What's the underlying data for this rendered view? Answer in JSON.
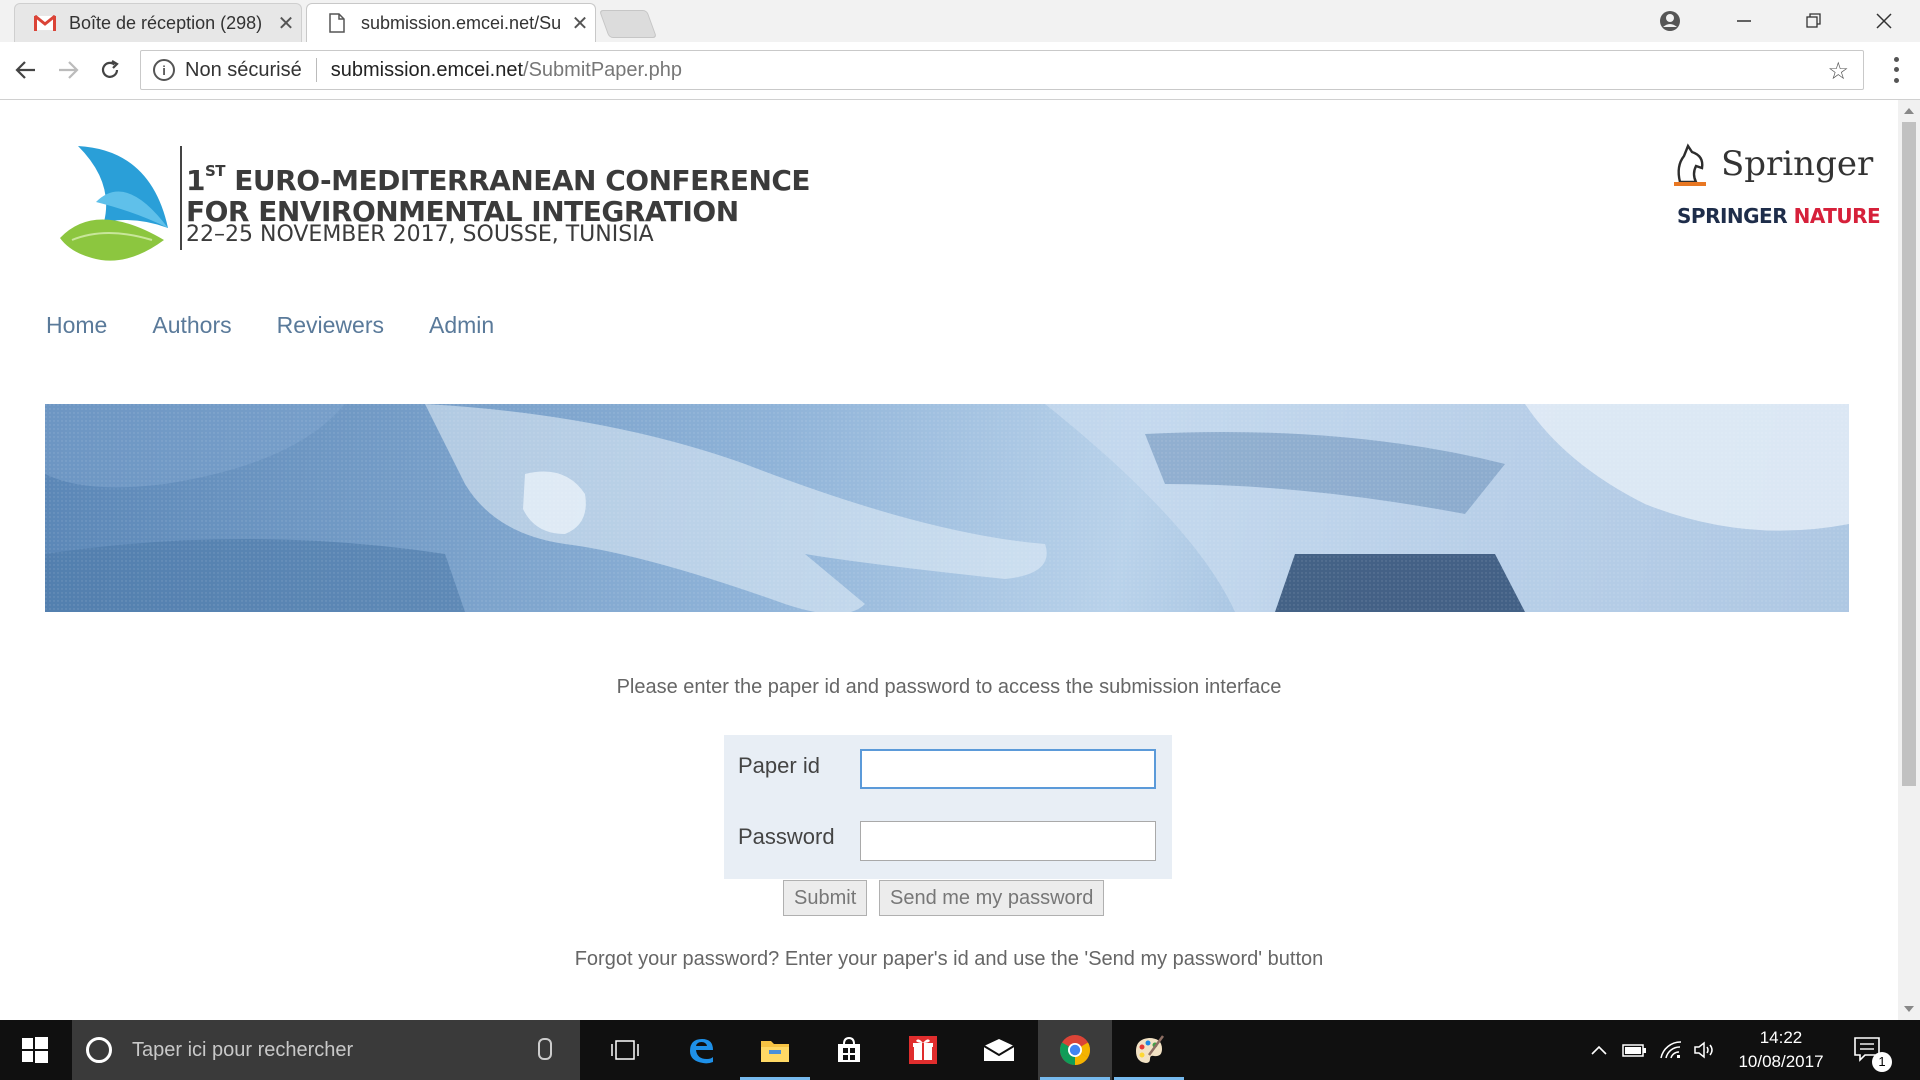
{
  "browser": {
    "tabs": [
      {
        "title": "Boîte de réception (298)",
        "icon": "gmail-icon",
        "active": false
      },
      {
        "title": "submission.emcei.net/Su",
        "icon": "page-icon",
        "active": true
      }
    ],
    "address": {
      "security_label": "Non sécurisé",
      "host": "submission.emcei.net",
      "path": "/SubmitPaper.php"
    }
  },
  "header": {
    "title_num": "1",
    "title_sup": "ST",
    "title_line1_rest": " EURO-MEDITERRANEAN CONFERENCE",
    "title_line2": "FOR ENVIRONMENTAL INTEGRATION",
    "date_place": "22–25 NOVEMBER 2017, SOUSSE, TUNISIA",
    "publisher": "Springer",
    "publisher_sub_1": "SPRINGER",
    "publisher_sub_2": "NATURE"
  },
  "nav": {
    "items": [
      "Home",
      "Authors",
      "Reviewers",
      "Admin"
    ]
  },
  "main": {
    "intro": "Please enter the paper id and password to access the submission interface",
    "form": {
      "paper_id_label": "Paper id",
      "paper_id_value": "",
      "password_label": "Password",
      "password_value": ""
    },
    "submit_label": "Submit",
    "send_password_label": "Send me my password",
    "forgot": "Forgot your password? Enter your paper's id and use the 'Send my password' button"
  },
  "taskbar": {
    "search_placeholder": "Taper ici pour rechercher",
    "time": "14:22",
    "date": "10/08/2017",
    "notification_count": "1",
    "apps": [
      "task-view-icon",
      "edge-icon",
      "file-explorer-icon",
      "store-icon",
      "gift-app-icon",
      "mail-icon",
      "chrome-icon",
      "paint-icon"
    ]
  },
  "colors": {
    "nav_link": "#5a7a9a",
    "form_bg": "#e8eef5",
    "focus_border": "#5b9ad9",
    "springer_nature_red": "#d6203a"
  }
}
